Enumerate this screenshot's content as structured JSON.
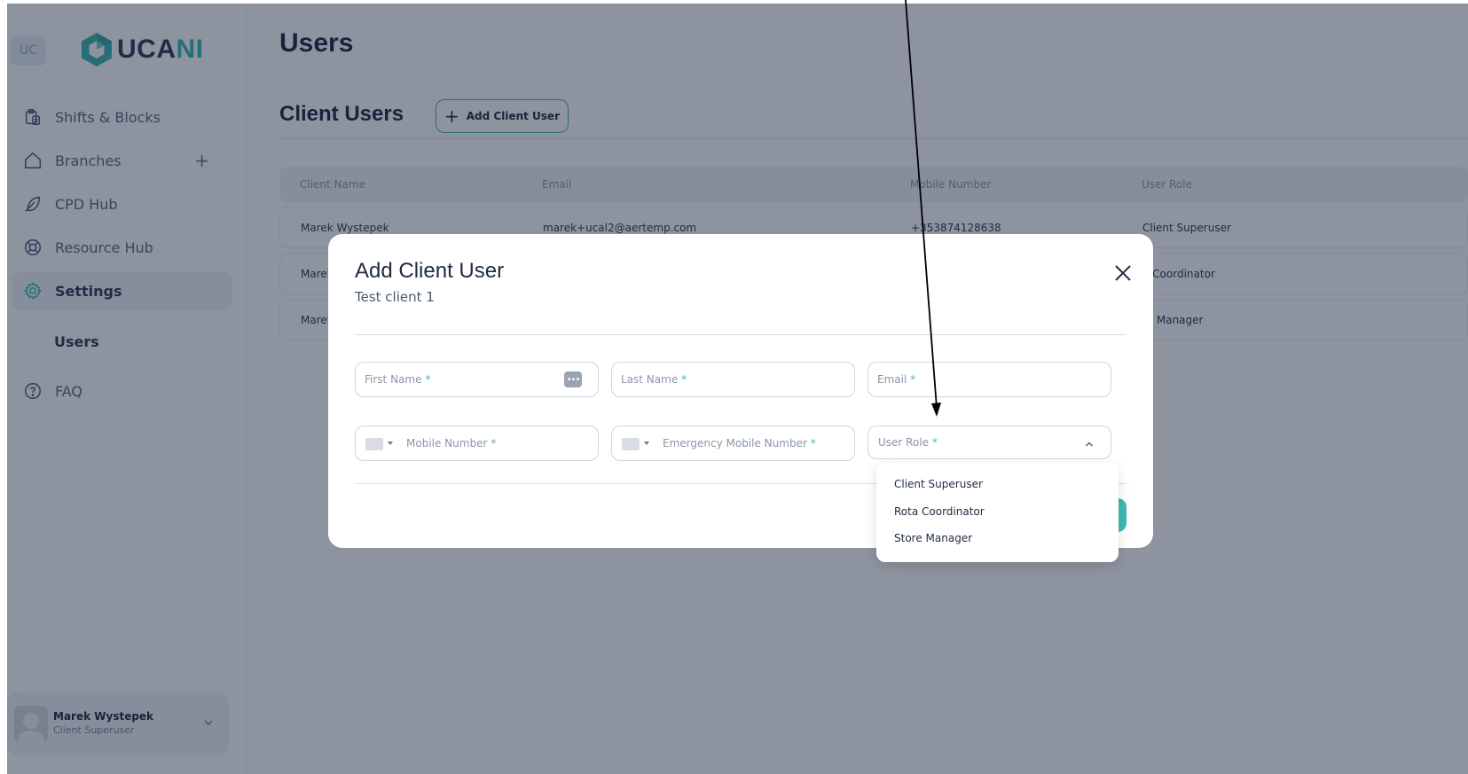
{
  "app": {
    "badge": "UC",
    "logo_dark": "UCA",
    "logo_teal": "NI"
  },
  "sidebar": {
    "items": [
      {
        "label": "Shifts & Blocks",
        "icon": "clipboard-icon"
      },
      {
        "label": "Branches",
        "icon": "home-icon",
        "action": "+"
      },
      {
        "label": "CPD Hub",
        "icon": "feather-icon"
      },
      {
        "label": "Resource Hub",
        "icon": "lifebuoy-icon"
      },
      {
        "label": "Settings",
        "icon": "gear-icon",
        "active": true
      },
      {
        "label": "FAQ",
        "icon": "help-icon"
      }
    ],
    "sub_item": "Users",
    "profile": {
      "name": "Marek Wystepek",
      "role": "Client Superuser"
    }
  },
  "main": {
    "title": "Users",
    "section_title": "Client Users",
    "add_button": "Add Client User",
    "table": {
      "headers": [
        "Client Name",
        "Email",
        "Mobile Number",
        "User Role"
      ],
      "rows": [
        [
          "Marek Wystepek",
          "marek+ucal2@aertemp.com",
          "+353874128638",
          "Client Superuser"
        ],
        [
          "Marek",
          "",
          "",
          "a Coordinator"
        ],
        [
          "Marek",
          "",
          "",
          "re Manager"
        ]
      ]
    }
  },
  "modal": {
    "title": "Add Client User",
    "subtitle": "Test client 1",
    "fields": {
      "first_name": "First Name",
      "last_name": "Last Name",
      "email": "Email",
      "mobile": "Mobile Number",
      "emergency": "Emergency Mobile Number",
      "user_role": "User Role",
      "required_mark": "*"
    },
    "password_icon_glyph": "•••",
    "dropdown_options": [
      "Client Superuser",
      "Rota Coordinator",
      "Store Manager"
    ]
  },
  "colors": {
    "accent": "#3fb9b1",
    "text_dark": "#1e2b40",
    "overlay": "rgba(16,30,54,0.48)"
  }
}
